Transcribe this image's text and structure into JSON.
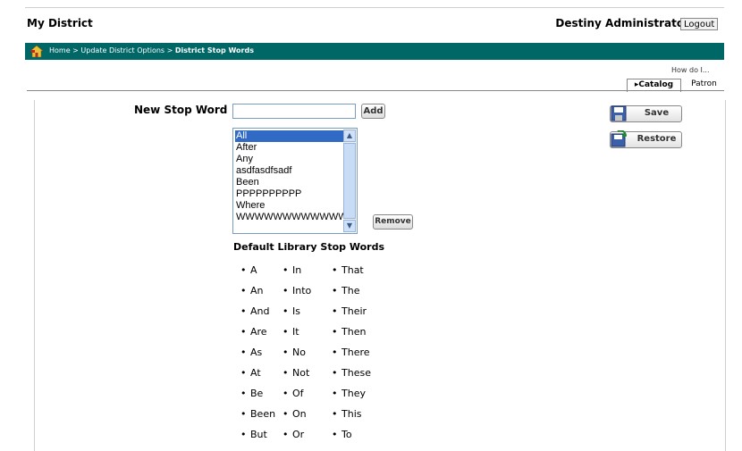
{
  "header": {
    "title": "My District",
    "user": "Destiny Administrator",
    "logout_label": "Logout"
  },
  "breadcrumb": {
    "parts": [
      "Home",
      "Update District Options",
      "District Stop Words"
    ],
    "sep": " > "
  },
  "help": {
    "label": "How do I..."
  },
  "tabs": [
    {
      "label": "▸Catalog",
      "active": true
    },
    {
      "label": "Patron",
      "active": false
    }
  ],
  "form": {
    "new_label": "New Stop Word",
    "new_value": "",
    "add_label": "Add",
    "remove_label": "Remove",
    "stop_words": [
      "All",
      "After",
      "Any",
      "asdfasdfsadf",
      "Been",
      "PPPPPPPPPP",
      "Where",
      "WWWWWWWWWWWW"
    ],
    "selected": "All"
  },
  "actions": {
    "save_label": "Save",
    "restore_label": "Restore"
  },
  "defaults": {
    "title": "Default Library Stop Words",
    "col1": [
      "A",
      "An",
      "And",
      "Are",
      "As",
      "At",
      "Be",
      "Been",
      "But"
    ],
    "col2": [
      "In",
      "Into",
      "Is",
      "It",
      "No",
      "Not",
      "Of",
      "On",
      "Or"
    ],
    "col3": [
      "That",
      "The",
      "Their",
      "Then",
      "There",
      "These",
      "They",
      "This",
      "To"
    ]
  },
  "colors": {
    "nav_bg": "#006666",
    "select_bg": "#316ac5"
  },
  "icons": [
    "home-icon",
    "save-icon",
    "restore-icon",
    "scroll-up-icon",
    "scroll-down-icon"
  ]
}
